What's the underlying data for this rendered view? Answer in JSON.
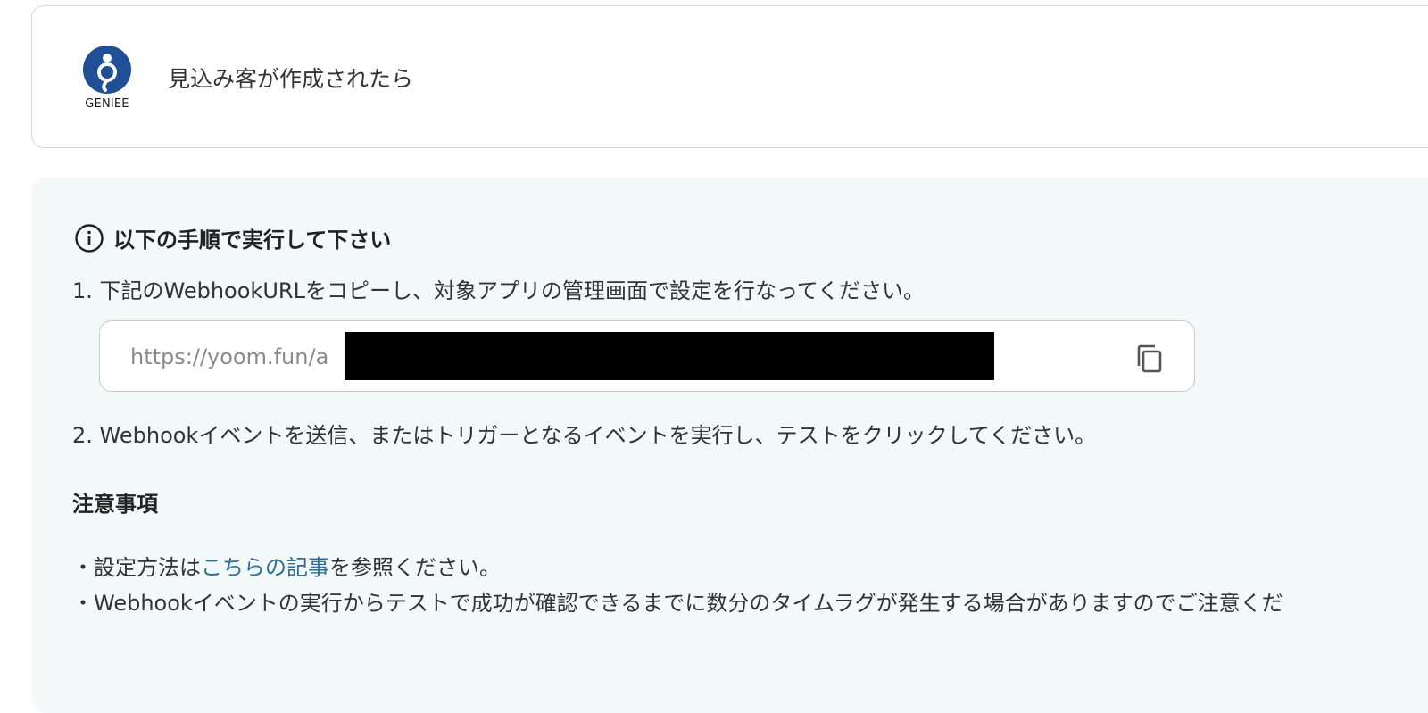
{
  "trigger": {
    "app_logo_text": "GENIEE",
    "title": "見込み客が作成されたら",
    "brand_color": "#1f4f96"
  },
  "instructions": {
    "heading": "以下の手順で実行して下さい",
    "step1": "1. 下記のWebhookURLをコピーし、対象アプリの管理画面で設定を行なってください。",
    "webhook_url_visible": "https://yoom.fun/a",
    "step2": "2. Webhookイベントを送信、またはトリガーとなるイベントを実行し、テストをクリックしてください。"
  },
  "notes": {
    "heading": "注意事項",
    "note1_prefix": "・設定方法は",
    "note1_link": "こちらの記事",
    "note1_suffix": "を参照ください。",
    "note2": "・Webhookイベントの実行からテストで成功が確認できるまでに数分のタイムラグが発生する場合がありますのでご注意くだ"
  },
  "colors": {
    "panel_background": "#f3f8f9",
    "link": "#2b6f97"
  },
  "icons": {
    "info": "info-circle-icon",
    "copy": "copy-icon"
  }
}
